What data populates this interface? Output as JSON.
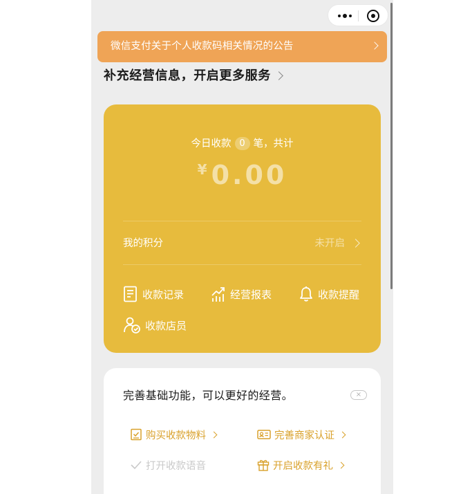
{
  "notice": {
    "text": "微信支付关于个人收款码相关情况的公告"
  },
  "promo": {
    "text": "补充经营信息，开启更多服务"
  },
  "summary": {
    "prefix": "今日收款",
    "count": "0",
    "suffix": "笔，共计",
    "currency": "¥",
    "amount": "0.00"
  },
  "points": {
    "label": "我的积分",
    "status": "未开启"
  },
  "functions": [
    {
      "label": "收款记录",
      "icon": "receipt-list-icon"
    },
    {
      "label": "经营报表",
      "icon": "trend-chart-icon"
    },
    {
      "label": "收款提醒",
      "icon": "bell-icon"
    },
    {
      "label": "收款店员",
      "icon": "clerk-user-icon"
    }
  ],
  "basic": {
    "title": "完善基础功能，可以更好的经营。",
    "close": "×",
    "options": [
      {
        "label": "购买收款物料",
        "icon": "material-icon",
        "done": false
      },
      {
        "label": "完善商家认证",
        "icon": "id-card-icon",
        "done": false
      },
      {
        "label": "打开收款语音",
        "icon": "check-icon",
        "done": true
      },
      {
        "label": "开启收款有礼",
        "icon": "gift-icon",
        "done": false
      }
    ]
  },
  "colors": {
    "card": "#e7bb3d",
    "notice": "#efa456",
    "accent": "#d9a12b",
    "background": "#ededed"
  }
}
